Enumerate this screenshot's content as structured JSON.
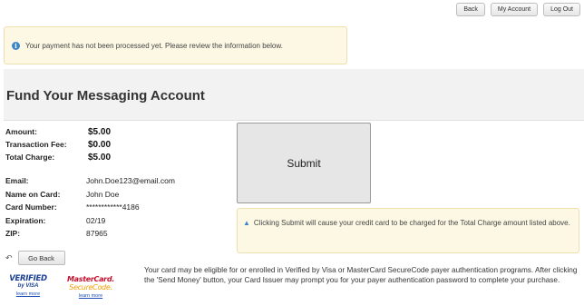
{
  "nav": {
    "back": "Back",
    "my_account": "My Account",
    "log_out": "Log Out"
  },
  "info_alert": {
    "icon": "info-icon",
    "text": "Your payment has not been processed yet. Please review the information below."
  },
  "page_title": "Fund Your Messaging Account",
  "amounts": [
    {
      "label": "Amount:",
      "value": "$5.00"
    },
    {
      "label": "Transaction Fee:",
      "value": "$0.00"
    },
    {
      "label": "Total Charge:",
      "value": "$5.00"
    }
  ],
  "details": [
    {
      "label": "Email:",
      "value": "John.Doe123@email.com"
    },
    {
      "label": "Name on Card:",
      "value": "John Doe"
    },
    {
      "label": "Card Number:",
      "value": "************4186"
    },
    {
      "label": "Expiration:",
      "value": "02/19"
    },
    {
      "label": "ZIP:",
      "value": "87965"
    }
  ],
  "submit_label": "Submit",
  "warning": {
    "icon": "warning-icon",
    "text": "Clicking Submit will cause your credit card to be charged for the Total Charge amount listed above."
  },
  "go_back_label": "Go Back",
  "logos": {
    "visa_main": "VERIFIED",
    "visa_sub": "by VISA",
    "visa_learn": "learn more",
    "mc_main": "MasterCard.",
    "mc_sub": "SecureCode.",
    "mc_learn": "learn more"
  },
  "disclaimer": "Your card may be eligible for or enrolled in Verified by Visa or MasterCard SecureCode payer authentication programs. After clicking the 'Send Money' button, your Card Issuer may prompt you for your payer authentication password to complete your purchase.",
  "colors": {
    "alert_bg": "#fdf8e4",
    "info_blue": "#3a87c8",
    "visa_blue": "#1a3f95",
    "mc_red": "#c8102e",
    "mc_orange": "#f29f05"
  }
}
